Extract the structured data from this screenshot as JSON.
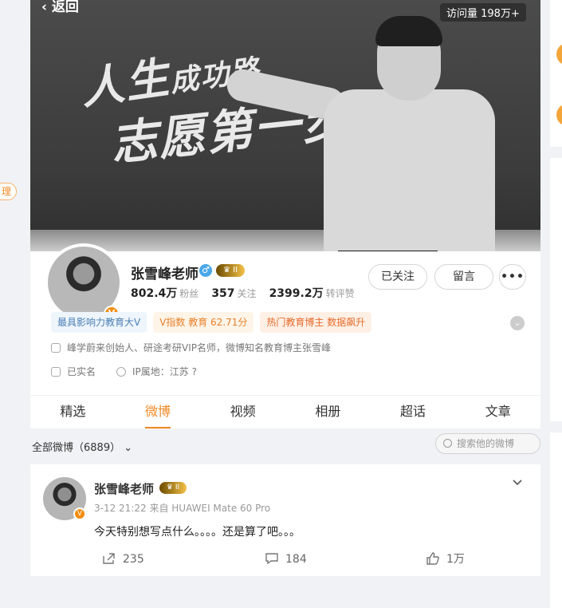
{
  "banner": {
    "back_label": "返回",
    "visits": "访问量 198万+",
    "chalk_line1": "人生",
    "chalk_line1_small": "成功路",
    "chalk_line2": "志愿第一步"
  },
  "profile": {
    "name": "张雪峰老师",
    "vip_level": "II",
    "stats": [
      {
        "value": "802.4万",
        "label": "粉丝"
      },
      {
        "value": "357",
        "label": "关注"
      },
      {
        "value": "2399.2万",
        "label": "转评赞"
      }
    ],
    "follow_button": "已关注",
    "message_button": "留言",
    "tags": [
      {
        "text": "最具影响力教育大V",
        "style": "blue"
      },
      {
        "text": "V指数 教育 62.71分",
        "style": "orange"
      },
      {
        "text": "热门教育博主 数据飙升",
        "style": "red"
      }
    ],
    "bio": "峰学蔚来创始人、研途考研VIP名师，微博知名教育博主张雪峰",
    "verified": "已实名",
    "ip_location": "IP属地：江苏"
  },
  "nav": {
    "tabs": [
      "精选",
      "微博",
      "视频",
      "相册",
      "超话",
      "文章"
    ],
    "active": 1
  },
  "filter": {
    "all_label": "全部微博（6889）",
    "search_placeholder": "搜索他的微博"
  },
  "post": {
    "author": "张雪峰老师",
    "vip_level": "II",
    "meta": "3-12 21:22 来自 HUAWEI Mate 60 Pro",
    "text": "今天特别想写点什么。。。。还是算了吧。。。",
    "forwards": "235",
    "comments": "184",
    "likes": "1万"
  },
  "sidebar_left": {
    "tag_fragment": "理"
  },
  "colors": {
    "accent": "#f08a24",
    "page_bg": "#f1f2f5",
    "verified_orange": "#f28c0f"
  }
}
